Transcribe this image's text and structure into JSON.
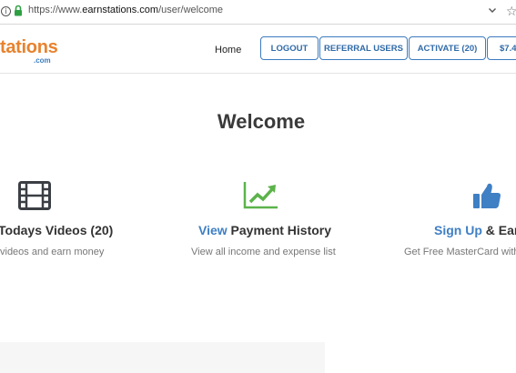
{
  "browser": {
    "url_prefix": "https://www.",
    "url_domain": "earnstations.com",
    "url_path": "/user/welcome",
    "info_glyph": "i",
    "star_glyph": "☆"
  },
  "header": {
    "logo_main": "tations",
    "logo_sub": ".com",
    "nav": {
      "home": "Home",
      "logout": "LOGOUT",
      "referral": "REFERRAL USERS",
      "activate": "ACTIVATE (20)",
      "balance": "$7.4"
    }
  },
  "main": {
    "title": "Welcome",
    "features": [
      {
        "icon": "film-icon",
        "title_highlight": "",
        "title_rest": "Todays Videos (20)",
        "description": "videos and earn money"
      },
      {
        "icon": "trending-up-icon",
        "title_highlight": "View",
        "title_rest": " Payment History",
        "description": "View all income and expense list"
      },
      {
        "icon": "thumbs-up-icon",
        "title_highlight": "Sign Up",
        "title_rest": " & Earn",
        "description": "Get Free MasterCard with"
      }
    ]
  },
  "colors": {
    "logo_orange": "#e8822e",
    "accent_blue": "#3d7bbf",
    "icon_green": "#5cb34b",
    "icon_dark": "#3b3f44"
  }
}
